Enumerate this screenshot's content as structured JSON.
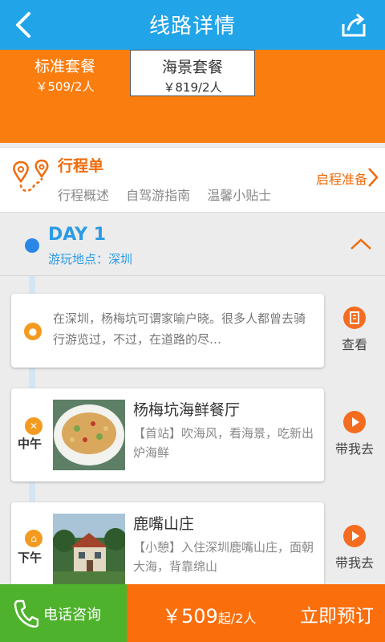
{
  "header": {
    "title": "线路详情"
  },
  "packages": [
    {
      "name": "标准套餐",
      "price": "￥509/2人"
    },
    {
      "name": "海景套餐",
      "price": "￥819/2人"
    }
  ],
  "itinerary": {
    "title": "行程单",
    "links": [
      "行程概述",
      "自驾游指南",
      "温馨小贴士"
    ],
    "prep": "启程准备"
  },
  "day": {
    "title": "DAY 1",
    "place": "游玩地点：深圳"
  },
  "cards": [
    {
      "desc": "在深圳，杨梅坑可谓家喻户晓。很多人都曾去骑行游览过，不过，在道路的尽…",
      "action": "查看"
    },
    {
      "time": "中午",
      "name": "杨梅坑海鲜餐厅",
      "info": "【首站】吹海风，看海景，吃新出炉海鲜",
      "action": "带我去"
    },
    {
      "time": "下午",
      "name": "鹿嘴山庄",
      "info": "【小憩】入住深圳鹿嘴山庄，面朝大海，背靠绵山",
      "action": "带我去"
    }
  ],
  "bottom": {
    "call": "电话咨询",
    "price_main": "￥509",
    "price_suffix": "起/2人",
    "book": "立即预订"
  },
  "colors": {
    "header": "#22a4e9",
    "accent": "#fa7d10",
    "call": "#4eb22c"
  }
}
